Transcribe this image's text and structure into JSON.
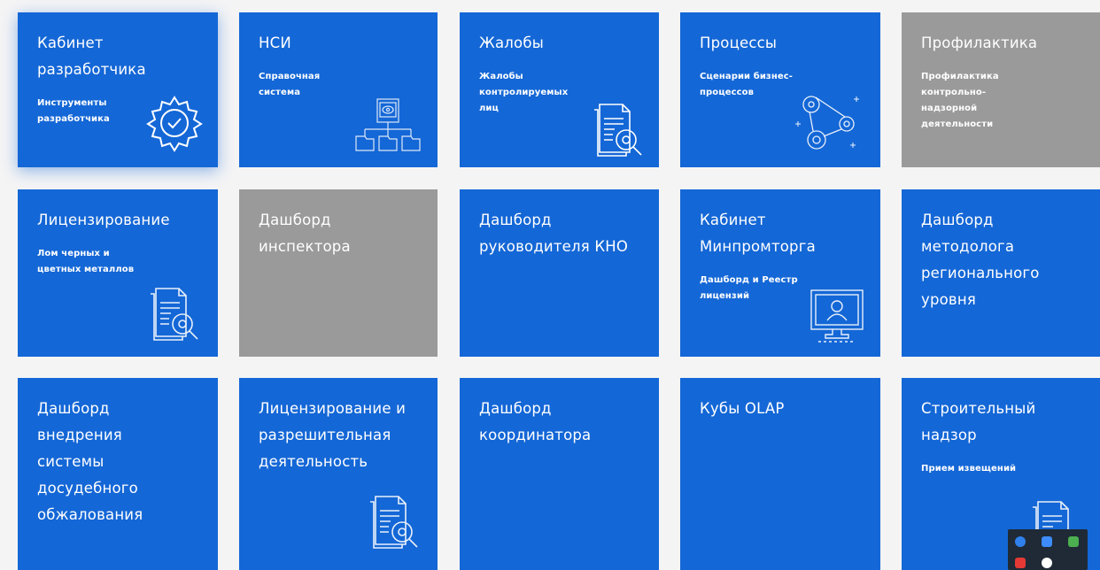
{
  "tiles": [
    {
      "id": "dev-cabinet",
      "title": "Кабинет\nразработчика",
      "subtitle": "Инструменты\nразработчика",
      "color": "blue",
      "icon": "gear-check-icon"
    },
    {
      "id": "nsi",
      "title": "НСИ",
      "subtitle": "Справочная\nсистема",
      "color": "blue",
      "icon": "hierarchy-document-icon"
    },
    {
      "id": "complaints",
      "title": "Жалобы",
      "subtitle": "Жалобы\nконтролируемых\nлиц",
      "color": "blue",
      "icon": "document-search-icon"
    },
    {
      "id": "processes",
      "title": "Процессы",
      "subtitle": "Сценарии бизнес-\nпроцессов",
      "color": "blue",
      "icon": "gears-process-icon"
    },
    {
      "id": "prevention",
      "title": "Профилактика",
      "subtitle": "Профилактика\nконтрольно-\nнадзорной\nдеятельности",
      "color": "gray",
      "icon": ""
    },
    {
      "id": "licensing",
      "title": "Лицензирование",
      "subtitle": "Лом черных и\nцветных металлов",
      "color": "blue",
      "icon": "document-search-icon"
    },
    {
      "id": "inspector-dashboard",
      "title": "Дашборд\nинспектора",
      "subtitle": "",
      "color": "gray",
      "icon": ""
    },
    {
      "id": "kno-head-dashboard",
      "title": "Дашборд\nруководителя КНО",
      "subtitle": "",
      "color": "blue",
      "icon": ""
    },
    {
      "id": "minpromtorg-cabinet",
      "title": "Кабинет\nМинпромторга",
      "subtitle": "Дашборд и Реестр\nлицензий",
      "color": "blue",
      "icon": "monitor-user-icon"
    },
    {
      "id": "methodologist-dashboard",
      "title": "Дашборд\nметодолога\nрегионального\nуровня",
      "subtitle": "",
      "color": "blue",
      "icon": ""
    },
    {
      "id": "pretrial-dashboard",
      "title": "Дашборд\nвнедрения\nсистемы\nдосудебного\nобжалования",
      "subtitle": "",
      "color": "blue",
      "icon": ""
    },
    {
      "id": "licensing-permits",
      "title": "Лицензирование и\nразрешительная\nдеятельность",
      "subtitle": "",
      "color": "blue",
      "icon": "document-search-icon"
    },
    {
      "id": "coordinator-dashboard",
      "title": "Дашборд\nкоординатора",
      "subtitle": "",
      "color": "blue",
      "icon": ""
    },
    {
      "id": "olap-cubes",
      "title": "Кубы OLAP",
      "subtitle": "",
      "color": "blue",
      "icon": ""
    },
    {
      "id": "construction-supervision",
      "title": "Строительный\nнадзор",
      "subtitle": "Прием извещений",
      "color": "blue",
      "icon": "document-search-icon"
    }
  ],
  "colors": {
    "tile_blue": "#1467d6",
    "tile_gray": "#9a9a9a",
    "background": "#f4f4f5"
  },
  "tray": {
    "icons": [
      "bluetooth-icon",
      "video-icon",
      "shield-check-icon",
      "app-icon",
      "antivirus-icon"
    ]
  }
}
